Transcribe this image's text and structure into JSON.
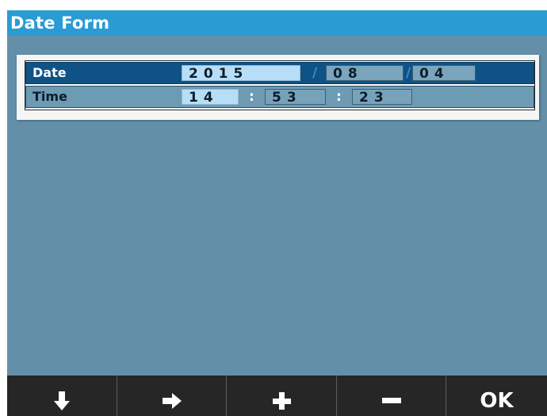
{
  "window": {
    "title": "Date Form"
  },
  "form": {
    "date": {
      "label": "Date",
      "year": "2015",
      "month": "08",
      "day": "04",
      "separator": "/"
    },
    "time": {
      "label": "Time",
      "hour": "14",
      "minute": "53",
      "second": "23",
      "separator": ":"
    }
  },
  "softkeys": [
    {
      "icon": "arrow-down-icon",
      "label": ""
    },
    {
      "icon": "arrow-right-icon",
      "label": ""
    },
    {
      "icon": "plus-icon",
      "label": ""
    },
    {
      "icon": "minus-icon",
      "label": ""
    },
    {
      "icon": "",
      "label": "OK"
    }
  ],
  "colors": {
    "title_bar": "#2b9bd3",
    "screen_bg": "#6390a8",
    "selected_row": "#0f5285",
    "active_field": "#b7def6",
    "softkey_bar": "#262626"
  }
}
